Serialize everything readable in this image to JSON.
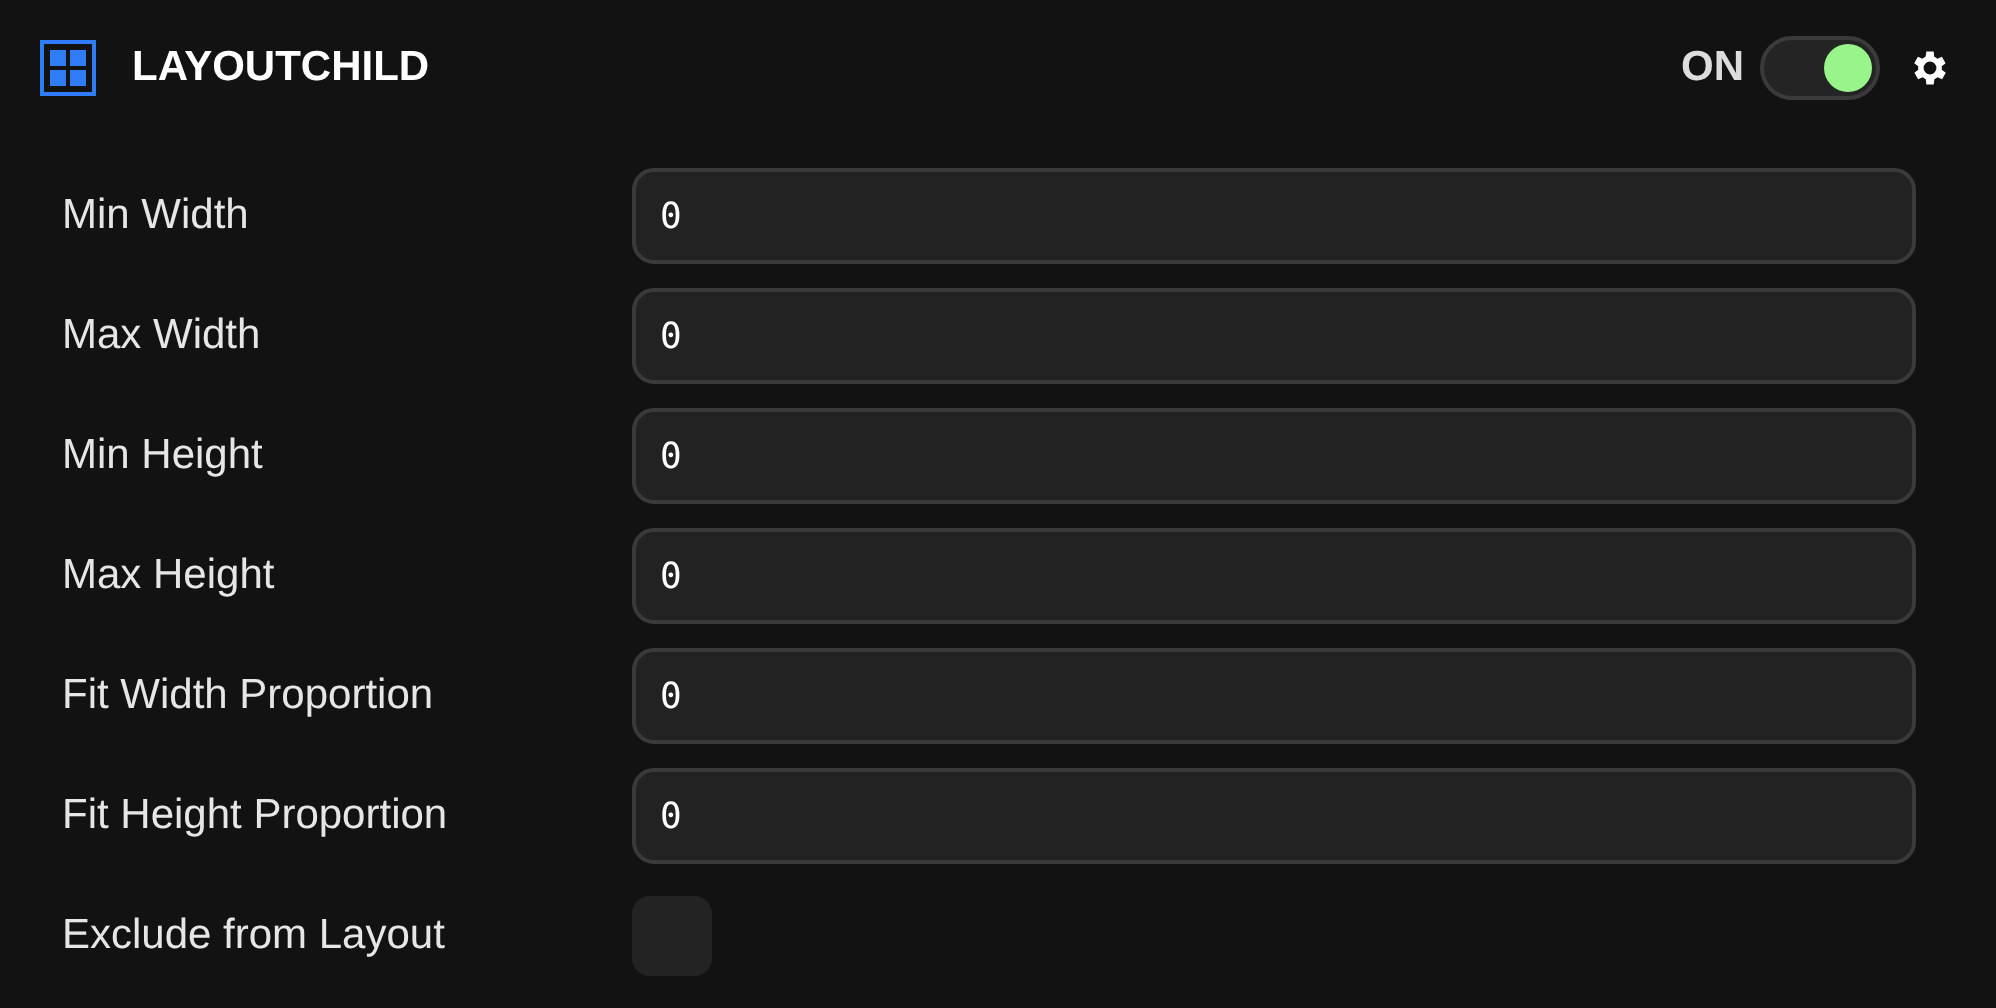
{
  "header": {
    "title": "LAYOUTCHILD",
    "toggle_label": "ON",
    "toggle": {
      "on": true
    }
  },
  "fields": [
    {
      "kind": "text",
      "label": "Min Width",
      "value": "0"
    },
    {
      "kind": "text",
      "label": "Max Width",
      "value": "0"
    },
    {
      "kind": "text",
      "label": "Min Height",
      "value": "0"
    },
    {
      "kind": "text",
      "label": "Max Height",
      "value": "0"
    },
    {
      "kind": "text",
      "label": "Fit Width Proportion",
      "value": "0"
    },
    {
      "kind": "text",
      "label": "Fit Height Proportion",
      "value": "0"
    },
    {
      "kind": "checkbox",
      "label": "Exclude from Layout",
      "checked": false
    }
  ]
}
